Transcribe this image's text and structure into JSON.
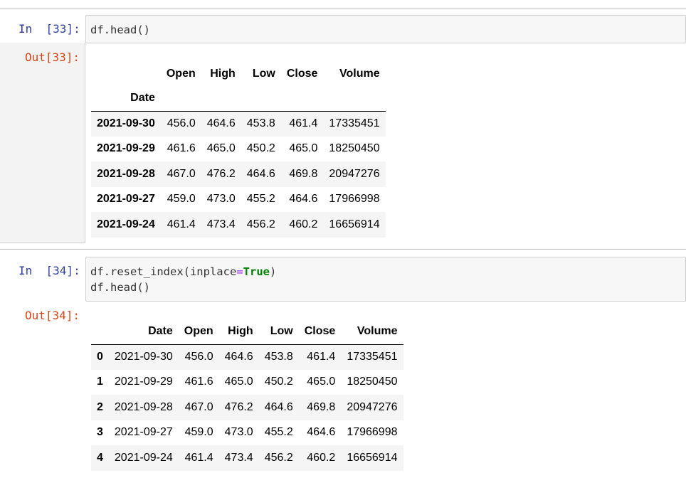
{
  "cell33": {
    "in_prompt": "In  [33]:",
    "out_prompt": "Out[33]:",
    "code": [
      "df.head()"
    ],
    "table": {
      "index_name": "Date",
      "columns": [
        "Open",
        "High",
        "Low",
        "Close",
        "Volume"
      ],
      "rows": [
        {
          "index": "2021-09-30",
          "values": [
            "456.0",
            "464.6",
            "453.8",
            "461.4",
            "17335451"
          ]
        },
        {
          "index": "2021-09-29",
          "values": [
            "461.6",
            "465.0",
            "450.2",
            "465.0",
            "18250450"
          ]
        },
        {
          "index": "2021-09-28",
          "values": [
            "467.0",
            "476.2",
            "464.6",
            "469.8",
            "20947276"
          ]
        },
        {
          "index": "2021-09-27",
          "values": [
            "459.0",
            "473.0",
            "455.2",
            "464.6",
            "17966998"
          ]
        },
        {
          "index": "2021-09-24",
          "values": [
            "461.4",
            "473.4",
            "456.2",
            "460.2",
            "16656914"
          ]
        }
      ]
    }
  },
  "cell34": {
    "in_prompt": "In  [34]:",
    "out_prompt": "Out[34]:",
    "code_line1_prefix": "df.reset_index(inplace",
    "code_line1_eq": "=",
    "code_line1_kw": "True",
    "code_line1_suffix": ")",
    "code_line2": "df.head()",
    "table": {
      "columns": [
        "",
        "Date",
        "Open",
        "High",
        "Low",
        "Close",
        "Volume"
      ],
      "rows": [
        {
          "index": "0",
          "values": [
            "2021-09-30",
            "456.0",
            "464.6",
            "453.8",
            "461.4",
            "17335451"
          ]
        },
        {
          "index": "1",
          "values": [
            "2021-09-29",
            "461.6",
            "465.0",
            "450.2",
            "465.0",
            "18250450"
          ]
        },
        {
          "index": "2",
          "values": [
            "2021-09-28",
            "467.0",
            "476.2",
            "464.6",
            "469.8",
            "20947276"
          ]
        },
        {
          "index": "3",
          "values": [
            "2021-09-27",
            "459.0",
            "473.0",
            "455.2",
            "464.6",
            "17966998"
          ]
        },
        {
          "index": "4",
          "values": [
            "2021-09-24",
            "461.4",
            "473.4",
            "456.2",
            "460.2",
            "16656914"
          ]
        }
      ]
    }
  },
  "colors": {
    "in_prompt": "#303f9f",
    "out_prompt": "#d84315",
    "keyword": "#008000"
  }
}
